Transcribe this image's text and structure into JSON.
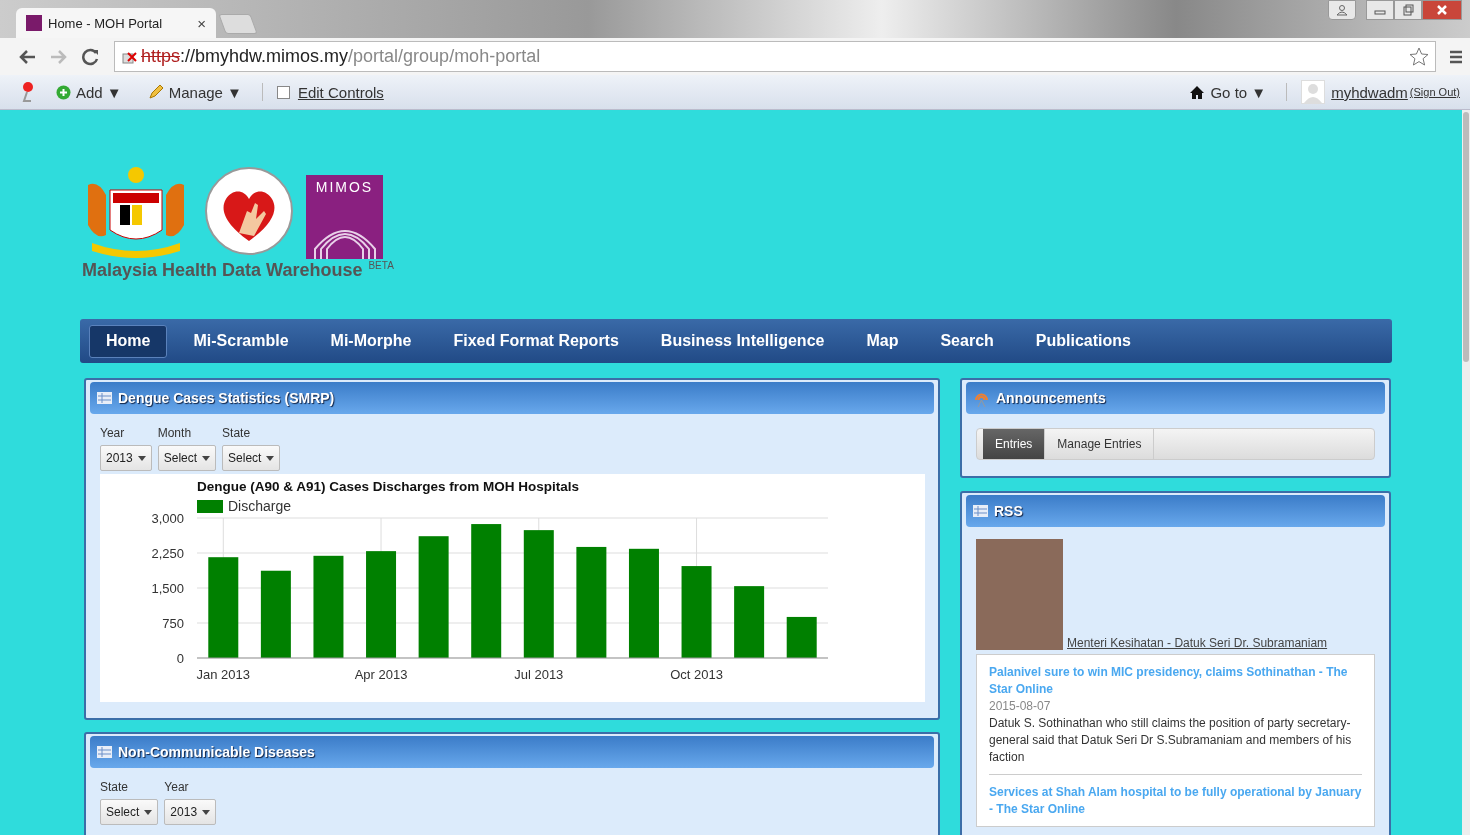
{
  "browser": {
    "tab_title": "Home - MOH Portal",
    "tab_close": "×",
    "url_scheme": "https",
    "url_host": "://bmyhdw.mimos.my",
    "url_path": "/portal/group/moh-portal"
  },
  "toolbar": {
    "add": "Add ▼",
    "manage": "Manage ▼",
    "edit_controls": {
      "label": "Edit Controls",
      "checked": false
    },
    "goto": "Go to ▼",
    "user": "myhdwadm",
    "sign_out": "(Sign Out)"
  },
  "header": {
    "logo_text": "MIMOS",
    "site_title": "Malaysia Health Data Warehouse",
    "badge": "BETA"
  },
  "nav": [
    {
      "label": "Home",
      "selected": true
    },
    {
      "label": "Mi-Scramble",
      "selected": false
    },
    {
      "label": "Mi-Morphe",
      "selected": false
    },
    {
      "label": "Fixed Format Reports",
      "selected": false
    },
    {
      "label": "Business Intelligence",
      "selected": false
    },
    {
      "label": "Map",
      "selected": false
    },
    {
      "label": "Search",
      "selected": false
    },
    {
      "label": "Publications",
      "selected": false
    }
  ],
  "dengue": {
    "title": "Dengue Cases Statistics (SMRP)",
    "filters": [
      {
        "label": "Year",
        "value": "2013"
      },
      {
        "label": "Month",
        "value": "Select"
      },
      {
        "label": "State",
        "value": "Select"
      }
    ],
    "chart_data": {
      "type": "bar",
      "title": "Dengue (A90 & A91) Cases Discharges from MOH Hospitals",
      "categories": [
        "Jan 2013",
        null,
        null,
        "Apr 2013",
        null,
        null,
        "Jul 2013",
        null,
        null,
        "Oct 2013",
        null,
        null
      ],
      "grid": true,
      "series": [
        {
          "name": "Discharge",
          "color": "#008000",
          "values": [
            2160,
            1870,
            2190,
            2290,
            2610,
            2870,
            2740,
            2380,
            2340,
            1970,
            1540,
            880
          ]
        }
      ],
      "ylim": [
        0,
        3000
      ],
      "yticks": [
        {
          "value": 0,
          "label": "0"
        },
        {
          "value": 750,
          "label": "750"
        },
        {
          "value": 1500,
          "label": "1,500"
        },
        {
          "value": 2250,
          "label": "2,250"
        },
        {
          "value": 3000,
          "label": "3,000"
        }
      ]
    }
  },
  "ncd": {
    "title": "Non-Communicable Diseases",
    "filters": [
      {
        "label": "State",
        "value": "Select"
      },
      {
        "label": "Year",
        "value": "2013"
      }
    ]
  },
  "announcements": {
    "title": "Announcements",
    "tabs": [
      {
        "label": "Entries",
        "selected": true
      },
      {
        "label": "Manage Entries",
        "selected": false
      }
    ]
  },
  "rss": {
    "title": "RSS",
    "photo_caption": "Menteri Kesihatan - Datuk Seri Dr. Subramaniam",
    "items": [
      {
        "headline": "Palanivel sure to win MIC presidency, claims Sothinathan - The Star Online",
        "date": "2015-08-07",
        "summary": "Datuk S. Sothinathan who still claims the position of party secretary-general said that Datuk Seri Dr S.Subramaniam and members of his faction"
      },
      {
        "headline": "Services at Shah Alam hospital to be fully operational by January - The Star Online"
      }
    ]
  }
}
